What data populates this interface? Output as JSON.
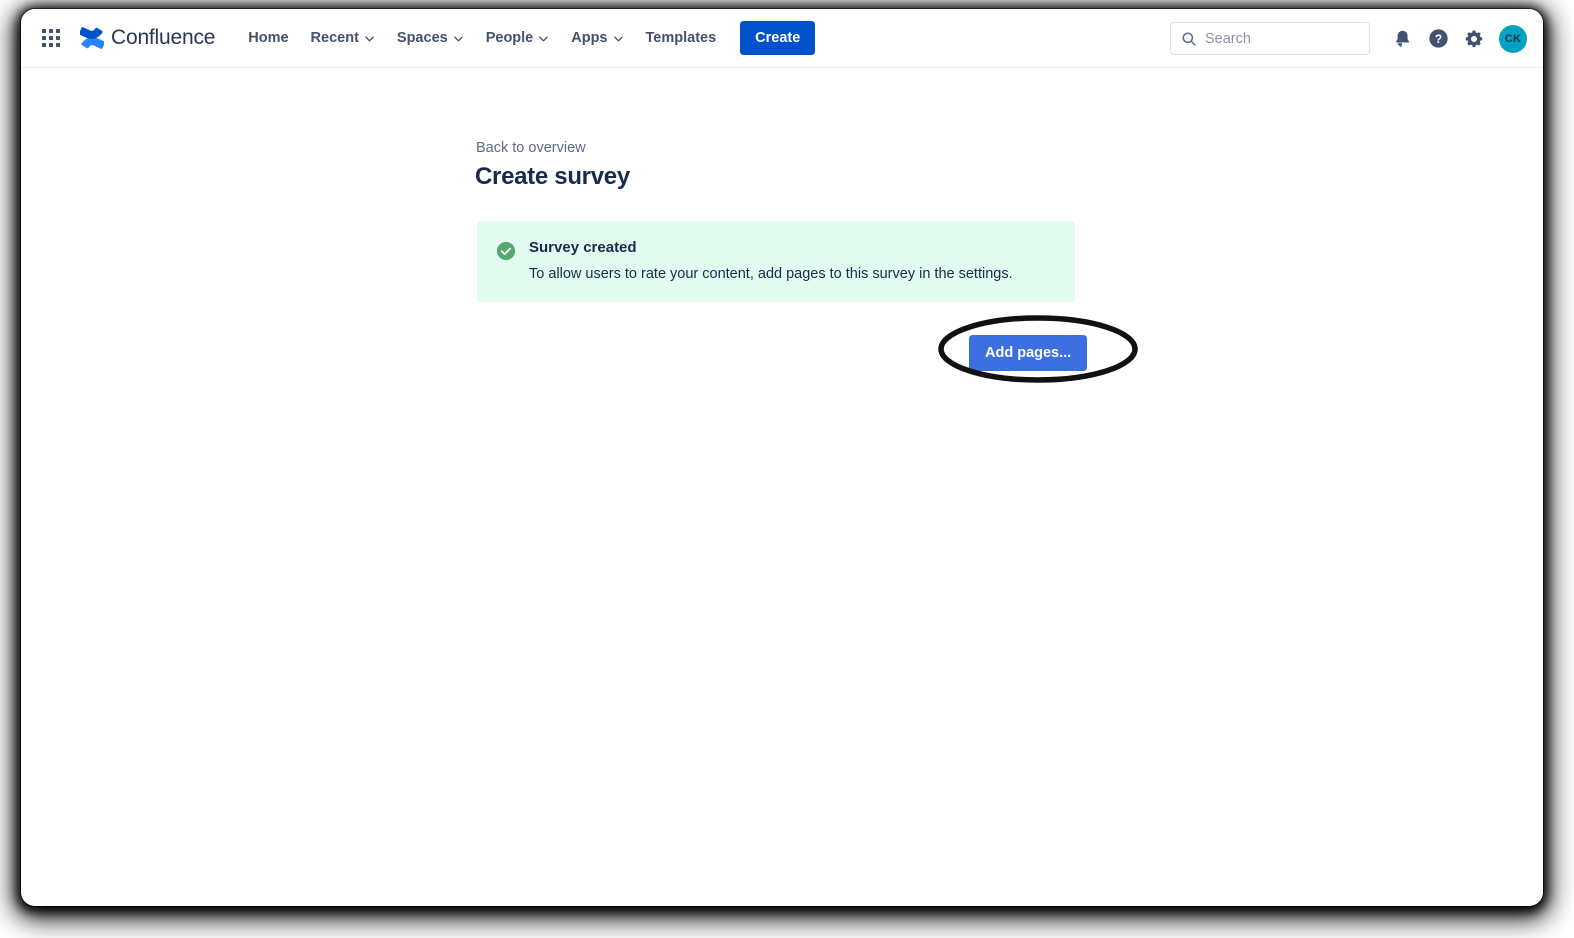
{
  "app": {
    "brand_name": "Confluence",
    "brand_color": "#0052CC",
    "accent_color": "#0052CC"
  },
  "topnav": {
    "app_switcher_label": "App switcher",
    "items": [
      {
        "label": "Home",
        "has_caret": false
      },
      {
        "label": "Recent",
        "has_caret": true
      },
      {
        "label": "Spaces",
        "has_caret": true
      },
      {
        "label": "People",
        "has_caret": true
      },
      {
        "label": "Apps",
        "has_caret": true
      },
      {
        "label": "Templates",
        "has_caret": false
      }
    ],
    "create_label": "Create",
    "search": {
      "placeholder": "Search",
      "value": ""
    },
    "icons": [
      {
        "name": "notifications-icon"
      },
      {
        "name": "help-icon"
      },
      {
        "name": "settings-gear-icon"
      }
    ],
    "avatar": {
      "initials": "CK",
      "color": "#00A3BF"
    }
  },
  "main": {
    "back_link": "Back to overview",
    "page_title": "Create survey",
    "banner": {
      "status_color": "#36B37E",
      "background_color": "#E3FCEF",
      "icon": "check-circle-icon",
      "title": "Survey created",
      "description": "To allow users to rate your content, add pages to this survey in the settings."
    },
    "add_pages_label": "Add pages...",
    "add_pages_color": "#3C6FE0",
    "highlight": {
      "shape": "ellipse",
      "color": "#111111",
      "target": "add-pages-button"
    }
  }
}
